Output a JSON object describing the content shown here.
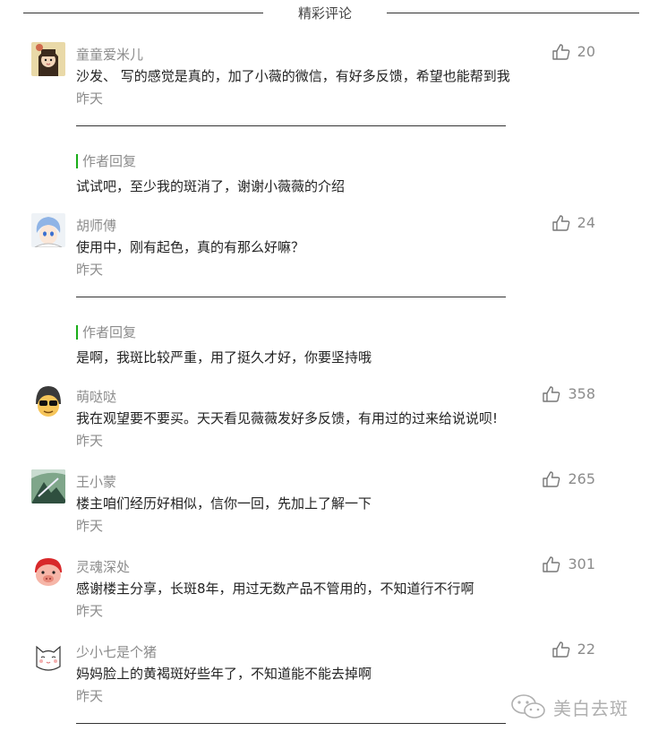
{
  "header": {
    "title": "精彩评论"
  },
  "comments": [
    {
      "nickname": "童童爱米儿",
      "content": "沙发、 写的感觉是真的，加了小薇的微信，有好多反馈，希望也能帮到我",
      "time": "昨天",
      "likes": "20",
      "avatar_icon": "girl-avatar-icon",
      "reply": {
        "label": "作者回复",
        "content": "试试吧，至少我的斑消了，谢谢小薇薇的介绍"
      }
    },
    {
      "nickname": "胡师傅",
      "content": "使用中，刚有起色，真的有那么好嘛？",
      "time": "昨天",
      "likes": "24",
      "avatar_icon": "anime-boy-avatar-icon",
      "reply": {
        "label": "作者回复",
        "content": "是啊，我斑比较严重，用了挺久才好，你要坚持哦"
      }
    },
    {
      "nickname": "萌哒哒",
      "content": "我在观望要不要买。天天看见薇薇发好多反馈，有用过的过来给说说呗!",
      "time": "昨天",
      "likes": "358",
      "avatar_icon": "sunglasses-cartoon-avatar-icon"
    },
    {
      "nickname": "王小蒙",
      "content": "楼主咱们经历好相似，信你一回，先加上了解一下",
      "time": "昨天",
      "likes": "265",
      "avatar_icon": "landscape-avatar-icon"
    },
    {
      "nickname": "灵魂深处",
      "content": "感谢楼主分享，长斑8年，用过无数产品不管用的，不知道行不行啊",
      "time": "昨天",
      "likes": "301",
      "avatar_icon": "pig-cartoon-avatar-icon"
    },
    {
      "nickname": "少小七是个猪",
      "content": "妈妈脸上的黄褐斑好些年了，不知道能不能去掉啊",
      "time": "昨天",
      "likes": "22",
      "avatar_icon": "cat-sketch-avatar-icon"
    }
  ],
  "watermark": {
    "text": "美白去斑",
    "icon": "wechat-logo-icon"
  },
  "colors": {
    "reply_accent": "#1aad19",
    "meta_text": "#8c8c8c",
    "body_text": "#222222"
  }
}
